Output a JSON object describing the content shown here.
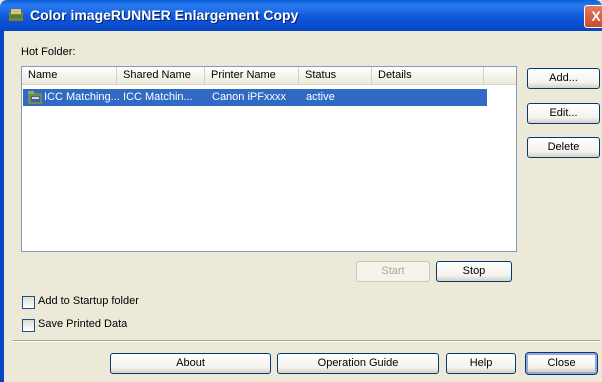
{
  "window": {
    "title": "Color imageRUNNER Enlargement Copy",
    "close_glyph": "X"
  },
  "hot_folder": {
    "label": "Hot Folder:",
    "columns": [
      "Name",
      "Shared Name",
      "Printer Name",
      "Status",
      "Details"
    ],
    "rows": [
      {
        "name": "ICC Matching...",
        "shared_name": "ICC Matchin...",
        "printer_name": "Canon iPFxxxx",
        "status": "active",
        "details": "",
        "selected": true,
        "icon": "folder-printer-icon"
      }
    ]
  },
  "side_buttons": {
    "add": "Add...",
    "edit": "Edit...",
    "delete": "Delete"
  },
  "control_buttons": {
    "start": "Start",
    "stop": "Stop"
  },
  "options": {
    "startup_label": "Add to Startup folder",
    "startup_checked": false,
    "save_label": "Save Printed Data",
    "save_checked": false
  },
  "bottom_buttons": {
    "about": "About",
    "guide": "Operation Guide",
    "help": "Help",
    "close": "Close"
  },
  "colors": {
    "titlebar": "#0a5fd8",
    "selection": "#316ac5",
    "face": "#ece9d8"
  }
}
